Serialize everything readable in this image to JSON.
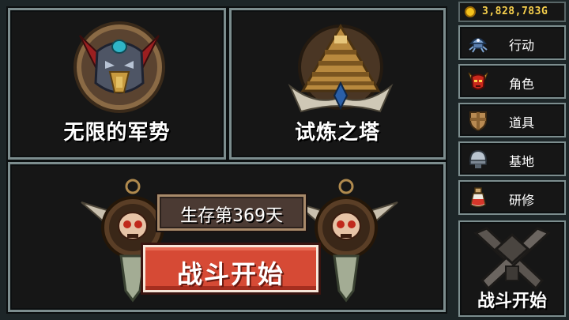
{
  "modes": {
    "legion_label": "无限的军势",
    "tower_label": "试炼之塔"
  },
  "battle": {
    "day_label": "生存第369天",
    "start_label": "战斗开始"
  },
  "currency": {
    "gold": "3,828,783G"
  },
  "menu": {
    "items": [
      {
        "label": "行动",
        "icon": "crab-robot-icon"
      },
      {
        "label": "角色",
        "icon": "red-demon-mask-icon"
      },
      {
        "label": "道具",
        "icon": "shield-icon"
      },
      {
        "label": "基地",
        "icon": "base-helmet-icon"
      },
      {
        "label": "研修",
        "icon": "potion-bottle-icon"
      }
    ],
    "battle_start_label": "战斗开始"
  },
  "colors": {
    "panel_border": "#7c8d8e",
    "start_button": "#d64a35",
    "gold_text": "#f7d04c"
  }
}
